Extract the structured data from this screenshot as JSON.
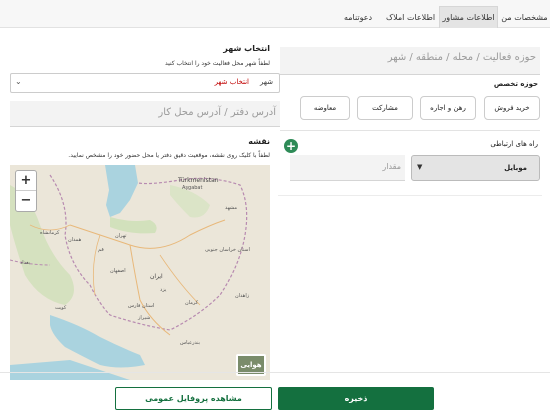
{
  "tabs": [
    {
      "label": "مشخصات من",
      "active": false
    },
    {
      "label": "اطلاعات مشاور",
      "active": true
    },
    {
      "label": "اطلاعات املاک",
      "active": false
    },
    {
      "label": "دعوتنامه",
      "active": false
    }
  ],
  "city": {
    "title": "انتخاب شهر",
    "hint": "لطفاً شهر محل فعالیت خود را انتخاب کنید",
    "select_label": "شهر",
    "select_value": "انتخاب شهر"
  },
  "address": {
    "placeholder": "آدرس دفتر / آدرس محل کار"
  },
  "map": {
    "title": "نقشه",
    "hint": "لطفاً با کلیک روی نقشه، موقعیت دقیق دفتر یا محل حضور خود را مشخص نمایید.",
    "zoom_in": "+",
    "zoom_out": "−",
    "layer_label": "هوایی",
    "labels": [
      {
        "text": "Türkmenistan"
      },
      {
        "text": "Aşgabat"
      },
      {
        "text": "مشهد"
      },
      {
        "text": "تهران"
      },
      {
        "text": "اصفهان"
      },
      {
        "text": "استان فارس"
      },
      {
        "text": "کرمان"
      },
      {
        "text": "ایران"
      },
      {
        "text": "شیراز"
      },
      {
        "text": "کرمانشاه"
      },
      {
        "text": "همدان"
      },
      {
        "text": "بغداد"
      },
      {
        "text": "کویت"
      },
      {
        "text": "یزد"
      },
      {
        "text": "بندرعباس"
      },
      {
        "text": "استان خراسان جنوبی"
      },
      {
        "text": "زاهدان"
      },
      {
        "text": "قم"
      }
    ]
  },
  "area": {
    "placeholder": "حوزه فعالیت / محله / منطقه / شهر"
  },
  "specialty": {
    "title": "حوزه تخصص",
    "buttons": [
      "خرید فروش",
      "رهن و اجاره",
      "مشارکت",
      "معاوضه"
    ]
  },
  "contact": {
    "title": "راه های ارتباطی",
    "select_value": "موبایل",
    "amount_placeholder": "مقدار",
    "add_icon": "+"
  },
  "footer": {
    "save": "ذخیره",
    "profile": "مشاهده پروفایل عمومی"
  },
  "colors": {
    "primary": "#14703f",
    "accent_red": "#c00000",
    "add_green": "#2e8b57"
  }
}
